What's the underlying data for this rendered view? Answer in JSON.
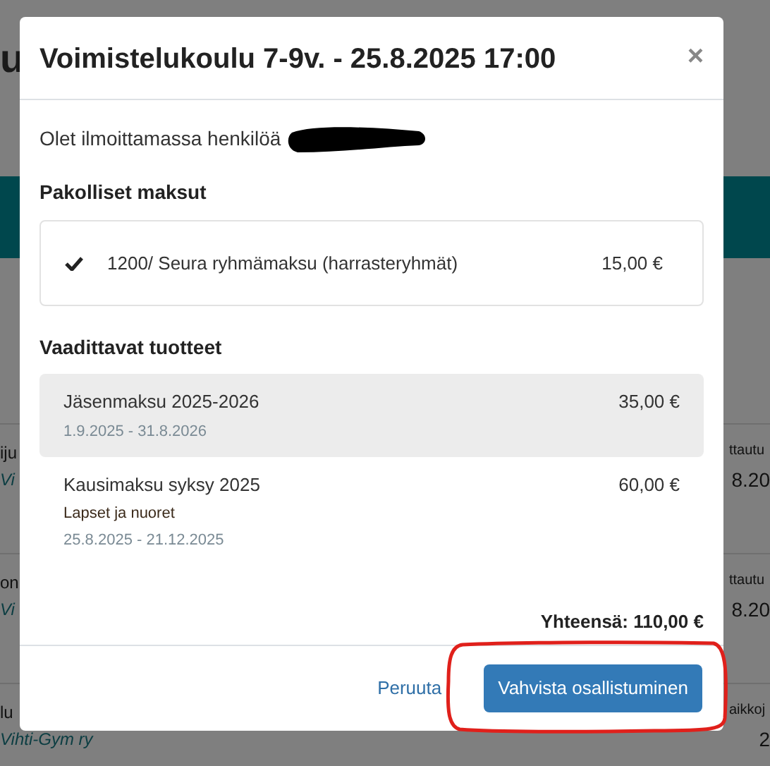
{
  "background": {
    "heading_fragment": "u",
    "rows": [
      {
        "title": "iju",
        "organizer": "Vi",
        "label": "ttautu",
        "value": "8.20"
      },
      {
        "title": "on",
        "organizer": "Vi",
        "label": "ttautu",
        "value": "8.20"
      },
      {
        "title": "lu",
        "organizer": "Vihti-Gym ry",
        "label": "aikkoj",
        "value": "2"
      }
    ]
  },
  "modal": {
    "title": "Voimistelukoulu 7-9v. - 25.8.2025 17:00",
    "close": "×",
    "intro": "Olet ilmoittamassa henkilöä",
    "mandatory": {
      "heading": "Pakolliset maksut",
      "items": [
        {
          "checked": true,
          "name": "1200/ Seura ryhmämaksu (harrasteryhmät)",
          "price": "15,00 €"
        }
      ]
    },
    "required": {
      "heading": "Vaadittavat tuotteet",
      "items": [
        {
          "highlighted": true,
          "name": "Jäsenmaksu 2025-2026",
          "dates": "1.9.2025 - 31.8.2026",
          "price": "35,00 €"
        },
        {
          "highlighted": false,
          "name": "Kausimaksu syksy 2025",
          "subtitle": "Lapset ja nuoret",
          "dates": "25.8.2025 - 21.12.2025",
          "price": "60,00 €"
        }
      ]
    },
    "total": "Yhteensä: 110,00 €",
    "cancel": "Peruuta",
    "confirm": "Vahvista osallistuminen"
  }
}
